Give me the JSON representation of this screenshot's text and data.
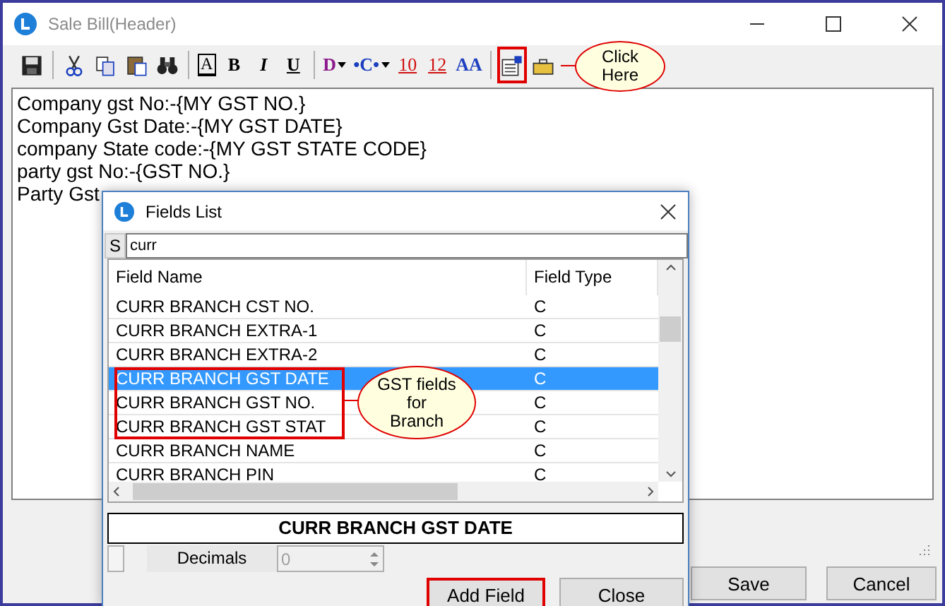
{
  "window": {
    "title": "Sale Bill(Header)"
  },
  "toolbar": [
    {
      "kind": "icon"
    },
    {
      "kind": "separator"
    },
    {
      "kind": "icon"
    },
    {
      "kind": "icon"
    },
    {
      "kind": "icon"
    },
    {
      "kind": "icon"
    },
    {
      "kind": "separator"
    },
    {
      "kind": "boxed",
      "label": "A"
    },
    {
      "kind": "bold",
      "label": "B"
    },
    {
      "kind": "italic",
      "label": "I"
    },
    {
      "kind": "underline",
      "label": "U"
    },
    {
      "kind": "separator"
    },
    {
      "kind": "dropdown",
      "label": "D",
      "color": "#8b1a8b"
    },
    {
      "kind": "arrows",
      "label": "•C•",
      "color": "#1a3fbf"
    },
    {
      "kind": "underline_red",
      "label": "10",
      "color": "#d01010"
    },
    {
      "kind": "underline_red",
      "label": "12",
      "color": "#d01010"
    },
    {
      "kind": "glyph",
      "label": "AA",
      "color": "#2040c0"
    },
    {
      "kind": "separator"
    },
    {
      "kind": "icon",
      "highlighted": true
    },
    {
      "kind": "icon",
      "highlighted": false
    }
  ],
  "toolbar_callout": {
    "lines": [
      "Click",
      "Here"
    ]
  },
  "editor": {
    "lines": [
      "Company gst No:-{MY GST NO.}",
      "Company Gst Date:-{MY GST DATE}",
      "company State code:-{MY GST STATE CODE}",
      "party gst No:-{GST NO.}",
      "Party Gst"
    ]
  },
  "buttons": [
    "Save",
    "Cancel"
  ],
  "dialog": {
    "title": "Fields List",
    "search": {
      "label": "S",
      "value": "curr"
    },
    "columns": [
      "Field Name",
      "Field Type"
    ],
    "rows": [
      {
        "name": "CURR BRANCH CST NO.",
        "type": "C",
        "selected": false
      },
      {
        "name": "CURR BRANCH EXTRA-1",
        "type": "C",
        "selected": false
      },
      {
        "name": "CURR BRANCH EXTRA-2",
        "type": "C",
        "selected": false
      },
      {
        "name": "CURR BRANCH GST DATE",
        "type": "C",
        "selected": true
      },
      {
        "name": "CURR BRANCH GST NO.",
        "type": "C",
        "selected": false
      },
      {
        "name": "CURR BRANCH GST STAT",
        "type": "C",
        "selected": false
      },
      {
        "name": "CURR BRANCH NAME",
        "type": "C",
        "selected": false
      },
      {
        "name": "CURR BRANCH PIN",
        "type": "C",
        "selected": false
      }
    ],
    "callout": {
      "lines": [
        "GST fields",
        "for",
        "Branch"
      ]
    },
    "selected_field": "CURR BRANCH GST DATE",
    "decimals": {
      "label": "Decimals",
      "value": "0",
      "disabled": true
    },
    "buttons": [
      {
        "label": "Add Field",
        "highlighted": true
      },
      {
        "label": "Close",
        "highlighted": false
      }
    ]
  }
}
